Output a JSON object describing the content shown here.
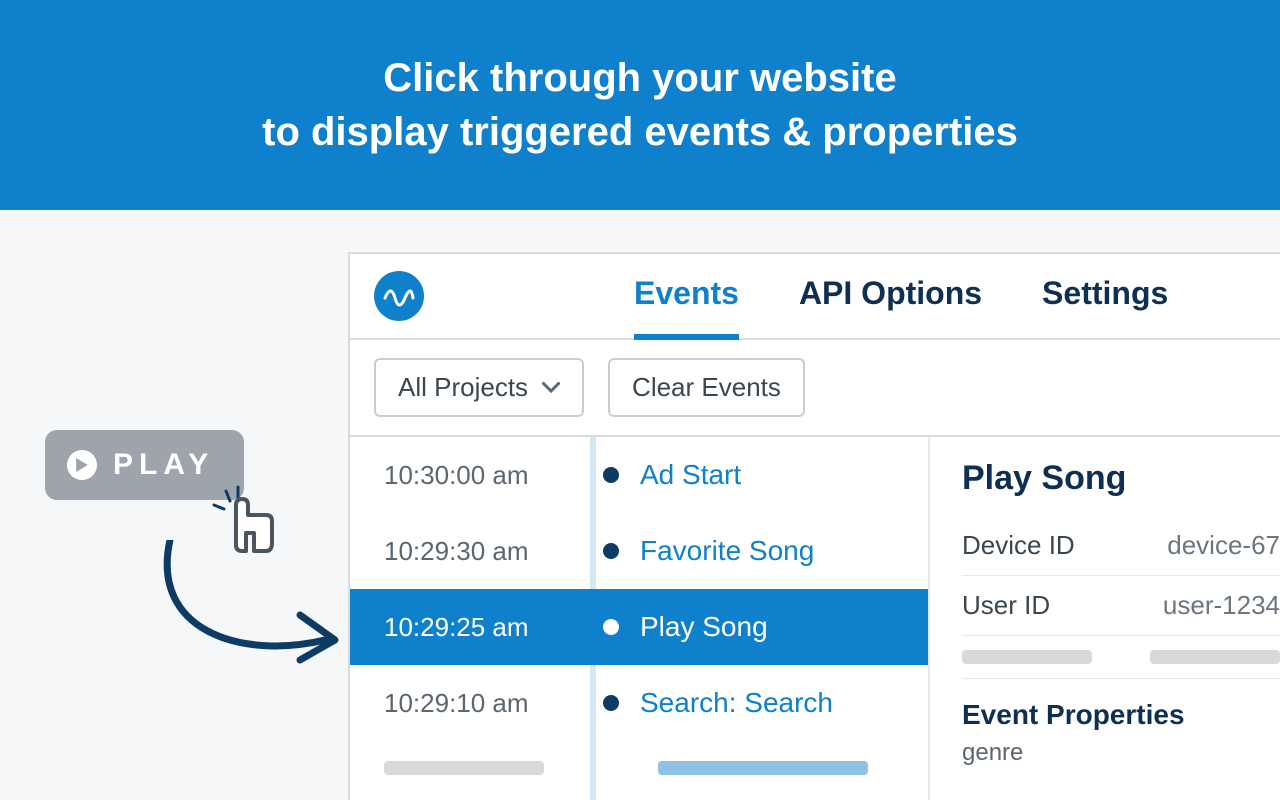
{
  "banner": {
    "line1": "Click through your website",
    "line2": "to display triggered events & properties"
  },
  "play_button": {
    "label": "PLAY"
  },
  "tabs": [
    {
      "label": "Events",
      "active": true
    },
    {
      "label": "API Options",
      "active": false
    },
    {
      "label": "Settings",
      "active": false
    }
  ],
  "toolbar": {
    "project_selector": "All Projects",
    "clear_button": "Clear Events"
  },
  "timeline": [
    {
      "time": "10:30:00 am",
      "name": "Ad Start",
      "selected": false
    },
    {
      "time": "10:29:30 am",
      "name": "Favorite Song",
      "selected": false
    },
    {
      "time": "10:29:25 am",
      "name": "Play Song",
      "selected": true
    },
    {
      "time": "10:29:10 am",
      "name": "Search: Search",
      "selected": false
    }
  ],
  "details": {
    "title": "Play Song",
    "rows": [
      {
        "k": "Device ID",
        "v": "device-67"
      },
      {
        "k": "User ID",
        "v": "user-1234"
      }
    ],
    "section": "Event Properties",
    "properties": [
      {
        "name": "genre"
      }
    ]
  }
}
